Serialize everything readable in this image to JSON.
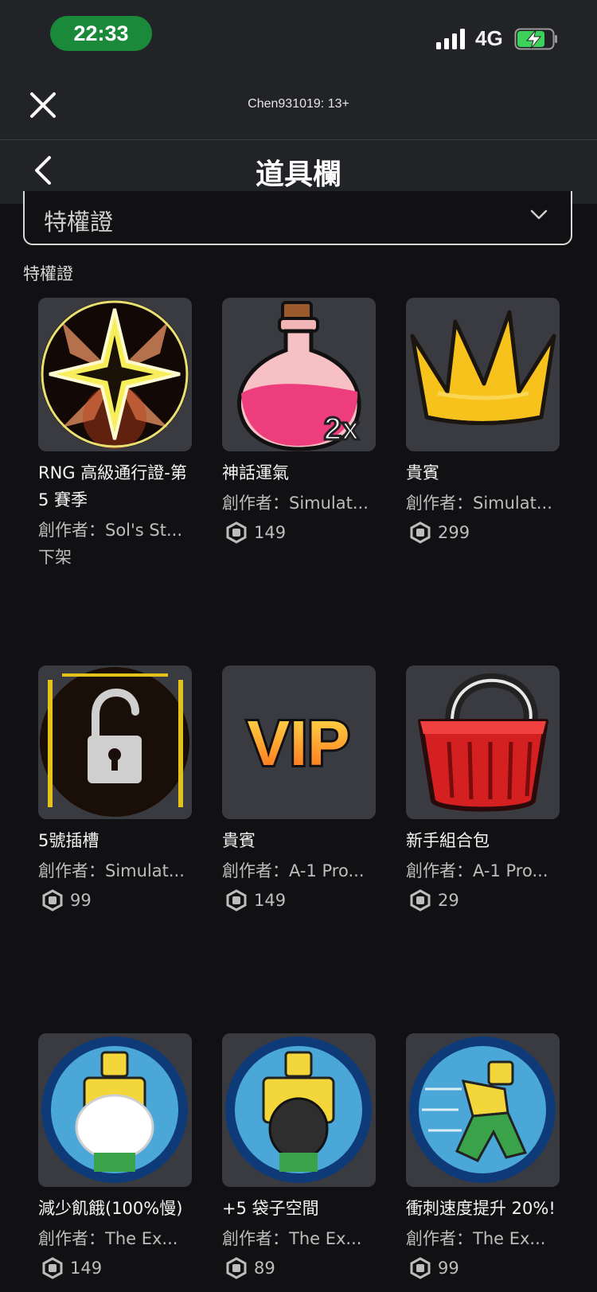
{
  "status_bar": {
    "time": "22:33",
    "network": "4G"
  },
  "nav": {
    "account_label": "Chen931019: 13+"
  },
  "header": {
    "title": "道具欄"
  },
  "filter": {
    "selected": "特權證"
  },
  "section": {
    "label": "特權證"
  },
  "items": [
    {
      "name": "RNG 高級通行證-第 5 賽季",
      "creator": "創作者：Sol's St...",
      "status": "下架",
      "thumbnail_icon": "star-badge-icon"
    },
    {
      "name": "神話運氣",
      "creator": "創作者：Simulat...",
      "price": "149",
      "thumbnail_icon": "potion-2x-icon"
    },
    {
      "name": "貴賓",
      "creator": "創作者：Simulat...",
      "price": "299",
      "thumbnail_icon": "crown-icon"
    },
    {
      "name": "5號插槽",
      "creator": "創作者：Simulat...",
      "price": "99",
      "thumbnail_icon": "padlock-icon"
    },
    {
      "name": "貴賓",
      "creator": "創作者：A-1 Pro...",
      "price": "149",
      "thumbnail_icon": "vip-text-icon",
      "thumb_text": "VIP"
    },
    {
      "name": "新手組合包",
      "creator": "創作者：A-1 Pro...",
      "price": "29",
      "thumbnail_icon": "basket-icon"
    },
    {
      "name": "減少飢餓(100%慢)",
      "creator": "創作者：The Ex...",
      "price": "149",
      "thumbnail_icon": "plate-avatar-icon"
    },
    {
      "name": "+5 袋子空間",
      "creator": "創作者：The Ex...",
      "price": "89",
      "thumbnail_icon": "bag-avatar-icon"
    },
    {
      "name": "衝刺速度提升 20%!",
      "creator": "創作者：The Ex...",
      "price": "99",
      "thumbnail_icon": "running-avatar-icon"
    }
  ],
  "colors": {
    "background": "#111114",
    "bar": "#222327",
    "time_pill": "#1a8a3a",
    "card": "#3a3b41"
  }
}
